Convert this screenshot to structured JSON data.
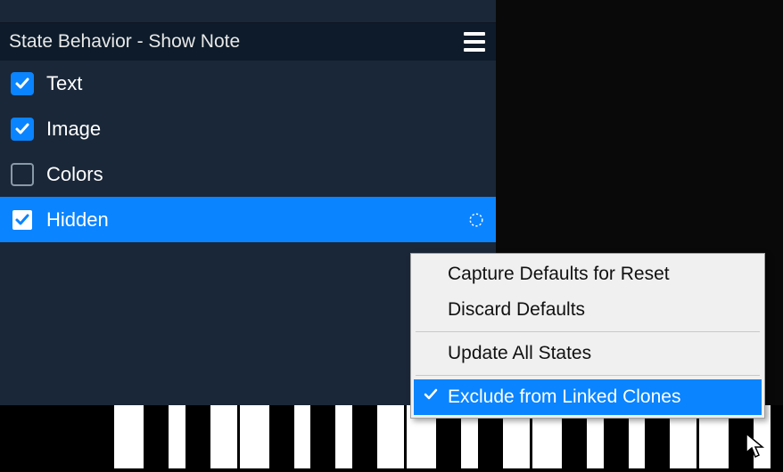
{
  "panel": {
    "title": "State Behavior - Show Note",
    "options": [
      {
        "label": "Text",
        "checked": true,
        "selected": false,
        "hasLinkIcon": false
      },
      {
        "label": "Image",
        "checked": true,
        "selected": false,
        "hasLinkIcon": false
      },
      {
        "label": "Colors",
        "checked": false,
        "selected": false,
        "hasLinkIcon": false
      },
      {
        "label": "Hidden",
        "checked": true,
        "selected": true,
        "hasLinkIcon": true
      }
    ]
  },
  "contextMenu": {
    "items": [
      {
        "label": "Capture Defaults for Reset",
        "checked": false,
        "highlighted": false,
        "separatorAfter": false
      },
      {
        "label": "Discard Defaults",
        "checked": false,
        "highlighted": false,
        "separatorAfter": true
      },
      {
        "label": "Update All States",
        "checked": false,
        "highlighted": false,
        "separatorAfter": true
      },
      {
        "label": "Exclude from Linked Clones",
        "checked": true,
        "highlighted": true,
        "separatorAfter": false
      }
    ]
  },
  "colors": {
    "accent": "#0a84ff",
    "panelBg": "#1a2738",
    "headerBg": "#0d1b2a",
    "menuBg": "#f0f0f0"
  }
}
